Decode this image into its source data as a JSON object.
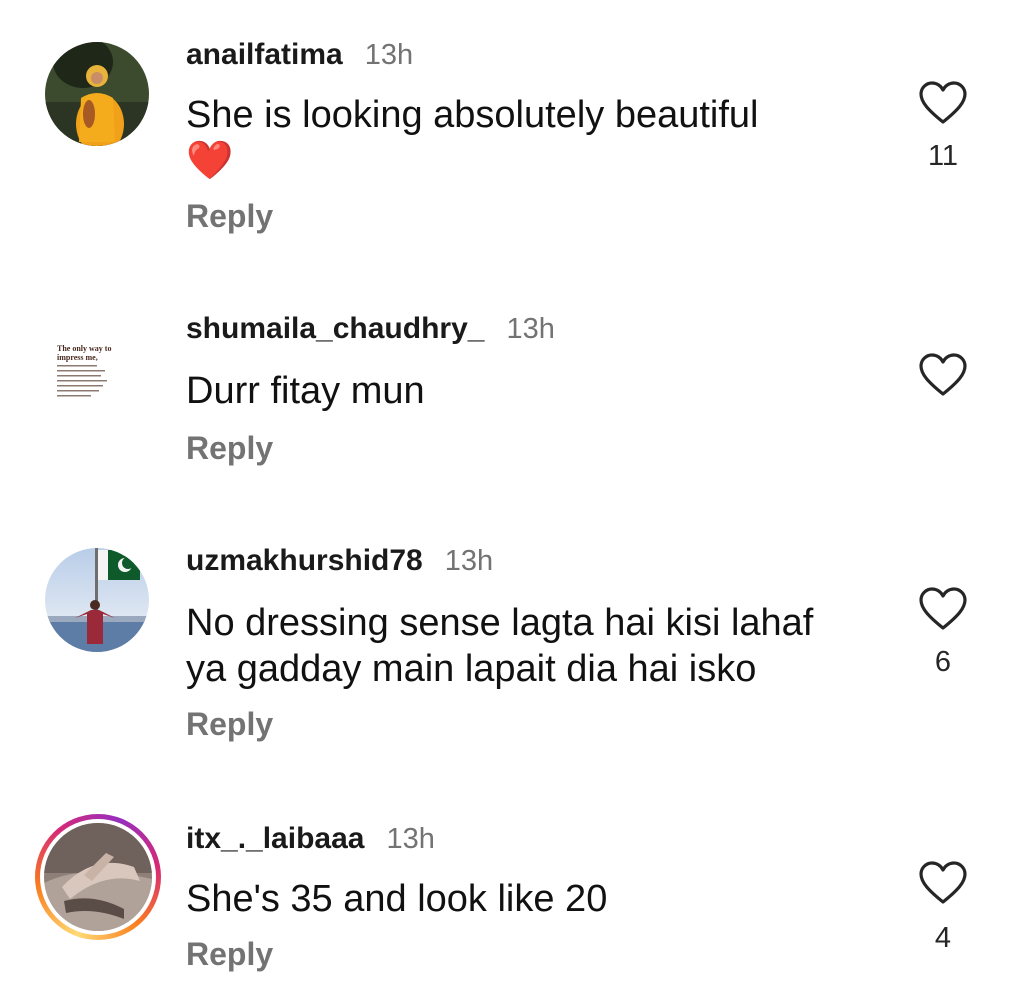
{
  "comments": [
    {
      "username": "anailfatima",
      "time": "13h",
      "text_line1": "She is looking absolutely beautiful",
      "text_line2": "❤️",
      "reply": "Reply",
      "likes": "11",
      "avatar_icon": "profile-photo-girl-yellow"
    },
    {
      "username": "shumaila_chaudhry_",
      "time": "13h",
      "text_line1": "Durr fitay mun",
      "reply": "Reply",
      "avatar_icon": "profile-quote-card",
      "avatar_quote_title": "The only way to impress me,"
    },
    {
      "username": "uzmakhurshid78",
      "time": "13h",
      "text_line1": "No dressing sense lagta hai kisi lahaf",
      "text_line2": "ya gadday main lapait dia hai isko",
      "reply": "Reply",
      "likes": "6",
      "avatar_icon": "profile-photo-flag"
    },
    {
      "username": "itx_._laibaaa",
      "time": "13h",
      "text_line1": "She's 35 and look like 20",
      "reply": "Reply",
      "likes": "4",
      "avatar_icon": "profile-photo-story-ring"
    }
  ],
  "colors": {
    "text": "#111111",
    "secondary": "#737373",
    "heart": "#e0245e"
  }
}
